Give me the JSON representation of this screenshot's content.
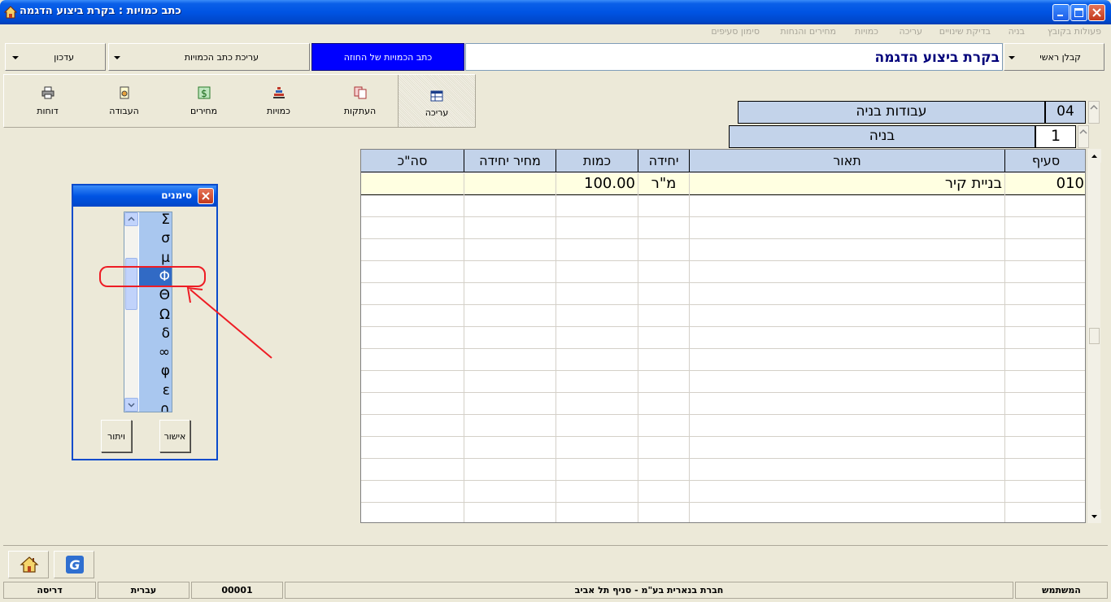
{
  "window": {
    "title": "כתב כמויות : בקרת ביצוע הדגמה"
  },
  "menu": [
    "פעולות בקובץ",
    "בניה",
    "בדיקת שינויים",
    "עריכה",
    "כמויות",
    "מחירים והנחות",
    "סימון סעיפים"
  ],
  "top": {
    "main_contractor": "קבלן ראשי",
    "project_name": "בקרת ביצוע הדגמה",
    "contract_bq": "כתב הכמויות של החוזה",
    "edit_bq": "עריכת כתב הכמויות",
    "update": "עדכון"
  },
  "toolbar": {
    "edit": "עריכה",
    "copies": "העתקות",
    "quantities": "כמויות",
    "prices": "מחירים",
    "processing": "העבודה",
    "reports": "דוחות"
  },
  "chapter": {
    "code": "04",
    "name": "עבודות בניה"
  },
  "subchapter": {
    "code": "1",
    "name": "בניה"
  },
  "grid": {
    "headers": {
      "item": "סעיף",
      "desc": "תאור",
      "unit": "יחידה",
      "qty": "כמות",
      "price": "מחיר יחידה",
      "total": "סה\"כ"
    },
    "rows": [
      {
        "item": "010",
        "desc": "בניית קיר",
        "unit": "מ\"ר",
        "qty": "100.00",
        "price": "",
        "total": ""
      }
    ]
  },
  "symbols_dialog": {
    "title": "סימנים",
    "symbols": [
      "Σ",
      "σ",
      "μ",
      "Φ",
      "Θ",
      "Ω",
      "δ",
      "∞",
      "φ",
      "ε",
      "∩"
    ],
    "selected": "Φ",
    "ok": "אישור",
    "cancel": "ויתור"
  },
  "status": {
    "user_label": "המשתמש",
    "company": "חברת בנארית בע\"מ - סניף תל אביב",
    "code": "00001",
    "language": "עברית",
    "mode": "דריסה"
  },
  "colors": {
    "title_blue": "#0054e3",
    "header_blue": "#c3d3ea",
    "active_row": "#ffffe1",
    "annotation_red": "#ee1c24"
  }
}
